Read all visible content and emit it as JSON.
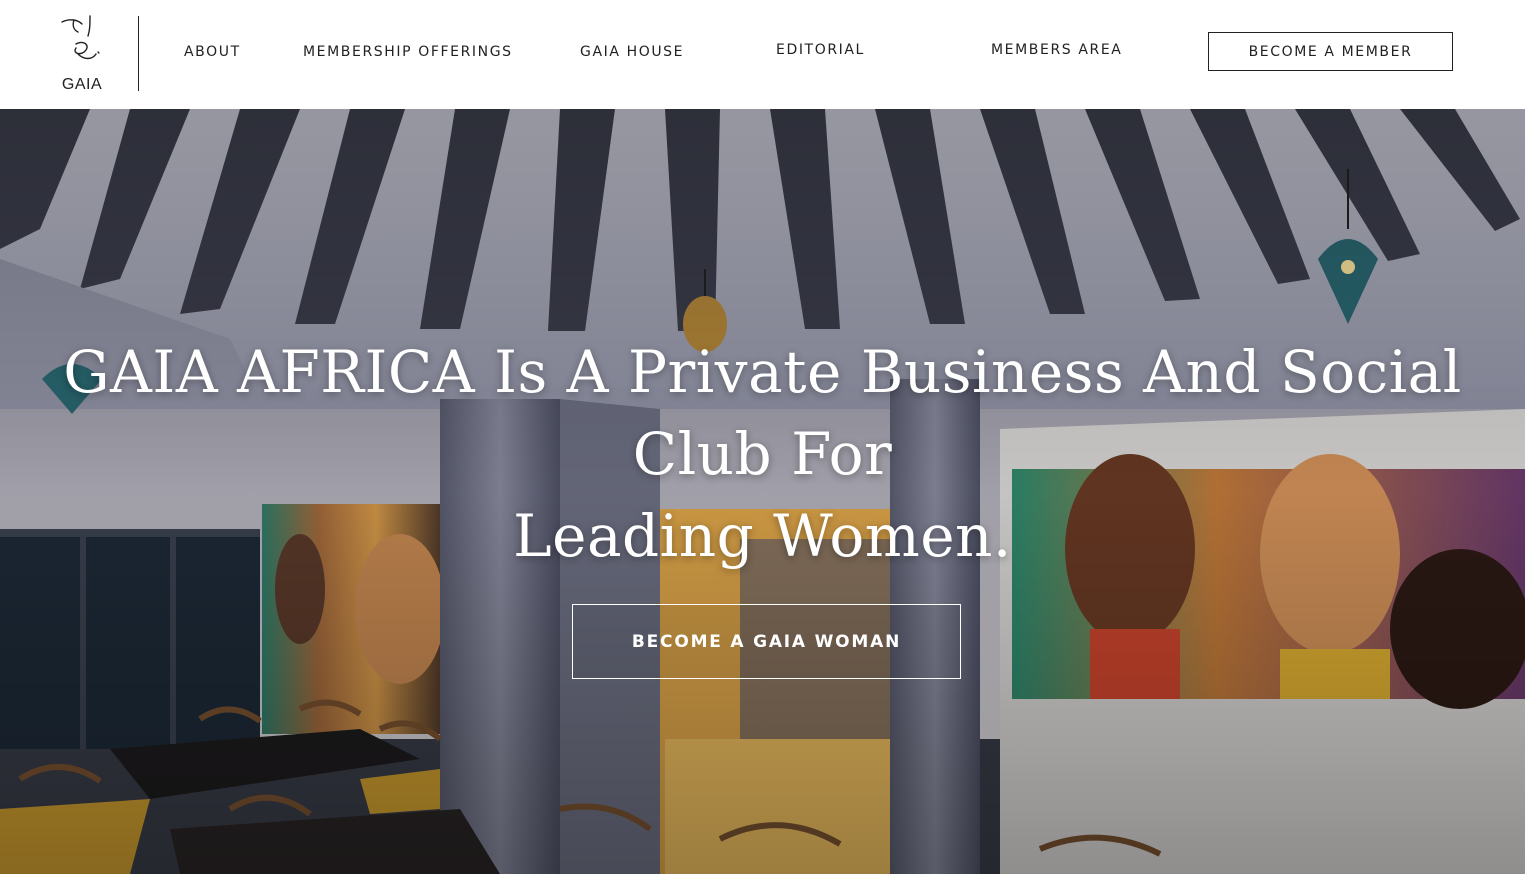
{
  "brand": {
    "logo_text": "GAIA",
    "logo_icon": "line-art-face-logo"
  },
  "nav": {
    "items": [
      {
        "label": "ABOUT"
      },
      {
        "label": "MEMBERSHIP OFFERINGS"
      },
      {
        "label": "GAIA HOUSE"
      },
      {
        "label": "EDITORIAL"
      },
      {
        "label": "MEMBERS AREA"
      }
    ],
    "cta_label": "BECOME A MEMBER"
  },
  "hero": {
    "title_line1": "GAIA AFRICA Is A Private Business And Social Club For",
    "title_line2": "Leading Women.",
    "cta_label": "BECOME A GAIA WOMAN",
    "background_description_icon": "restaurant-interior-photo"
  },
  "colors": {
    "text": "#222222",
    "header_bg": "#ffffff",
    "hero_text": "#ffffff"
  }
}
